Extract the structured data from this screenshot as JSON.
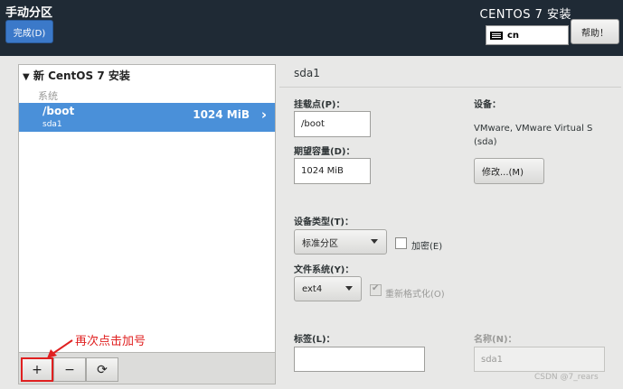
{
  "header": {
    "title": "手动分区",
    "done_label": "完成(D)",
    "product": "CENTOS 7 安装",
    "keyboard_layout": "cn",
    "help_label": "帮助！"
  },
  "tree": {
    "group_label": "新 CentOS 7 安装",
    "section_label": "系统",
    "selected_row": {
      "mount_point": "/boot",
      "device": "sda1",
      "size": "1024 MiB"
    }
  },
  "toolbar": {
    "add": "+",
    "remove": "−",
    "refresh": "⟳"
  },
  "annotation": {
    "text": "再次点击加号",
    "color": "#e02020"
  },
  "details": {
    "title": "sda1",
    "mount_point_label": "挂载点(P)：",
    "mount_point_value": "/boot",
    "capacity_label": "期望容量(D)：",
    "capacity_value": "1024 MiB",
    "device_label": "设备：",
    "device_desc": "VMware, VMware Virtual S (sda)",
    "modify_label": "修改...(M)",
    "device_type_label": "设备类型(T)：",
    "device_type_value": "标准分区",
    "encrypt_label": "加密(E)",
    "fs_label": "文件系统(Y)：",
    "fs_value": "ext4",
    "reformat_label": "重新格式化(O)",
    "tag_label": "标签(L)：",
    "tag_value": "",
    "name_label": "名称(N)：",
    "name_value": "sda1"
  },
  "watermark": "CSDN @7_rears",
  "colors": {
    "header_bg": "#1f2a35",
    "accent": "#4a90d9",
    "done_button": "#3b79c9"
  }
}
